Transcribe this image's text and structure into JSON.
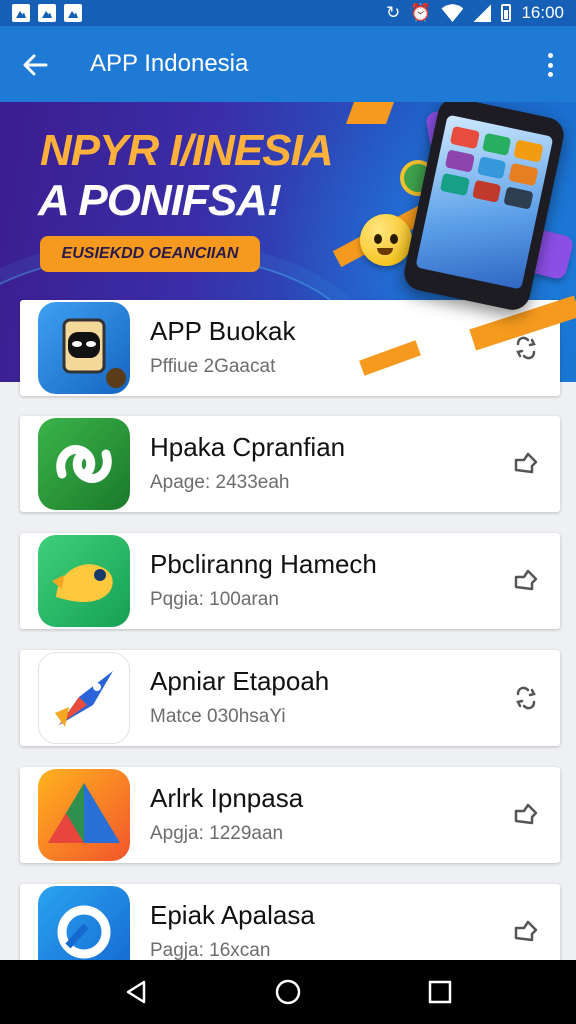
{
  "status_bar": {
    "time": "16:00",
    "left_icons": [
      "notification-icon",
      "notification-icon",
      "notification-icon"
    ],
    "right_icons": [
      "sync-icon",
      "alarm-icon",
      "wifi-icon",
      "signal-icon",
      "battery-icon"
    ]
  },
  "app_bar": {
    "title": "APP Indonesia",
    "back_icon": "arrow-left-icon",
    "menu_icon": "more-vertical-icon",
    "color": "#1f7ad6"
  },
  "banner": {
    "headline_1": "NPYR I/INESIA",
    "headline_2": "A PONIFSA!",
    "pill": "EUSIEKDD OEANCIIAN"
  },
  "apps": [
    {
      "name": "APP Buokak",
      "meta": "Pffiue 2Gaacat",
      "icon": "app-icon-mask",
      "action_icon": "share-icon"
    },
    {
      "name": "Hpaka Cpranfian",
      "meta": "Apage: 2433eah",
      "icon": "app-icon-green-swirl",
      "action_icon": "share-icon"
    },
    {
      "name": "Pbcliranng Hamech",
      "meta": "Pqgia: 100aran",
      "icon": "app-icon-fish",
      "action_icon": "share-icon"
    },
    {
      "name": "Apniar Etapoah",
      "meta": "Matce 030hsaYi",
      "icon": "app-icon-rocket",
      "action_icon": "share-icon"
    },
    {
      "name": "Arlrk Ipnpasa",
      "meta": "Apgja: 1229aan",
      "icon": "app-icon-triangle",
      "action_icon": "share-icon"
    },
    {
      "name": "Epiak Apalasa",
      "meta": "Pagja: 16xcan",
      "icon": "app-icon-ring",
      "action_icon": "share-icon"
    }
  ],
  "nav": {
    "back": "nav-back-icon",
    "home": "nav-home-icon",
    "recents": "nav-recents-icon"
  }
}
